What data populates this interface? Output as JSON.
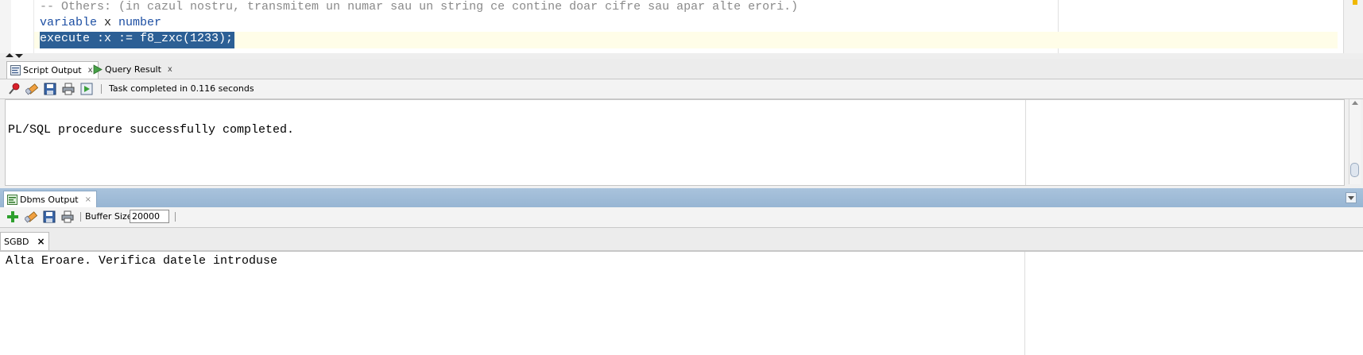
{
  "editor": {
    "line1": "-- Others: (in cazul nostru, transmitem un numar sau un string ce contine doar cifre sau apar alte erori.)",
    "line2_kw1": "variable",
    "line2_plain": " x ",
    "line2_kw2": "number",
    "line3": "execute :x := f8_zxc(1233);"
  },
  "output_tabs": [
    {
      "label": "Script Output",
      "close": "x",
      "icon": "script-output-icon"
    },
    {
      "label": "Query Result",
      "close": "x",
      "icon": "run-triangle-icon"
    }
  ],
  "script_toolbar": {
    "status": "Task completed in 0.116 seconds"
  },
  "script_output": {
    "text": "PL/SQL procedure successfully completed."
  },
  "dbms_panel": {
    "tab_label": "Dbms Output",
    "tab_close": "×",
    "buffer_label": "Buffer Size:",
    "buffer_value": "20000",
    "connection_tab": "SGBD",
    "connection_close": "×",
    "text": "Alta Eroare. Verifica datele introduse"
  },
  "colors": {
    "selection": "#2c5f95",
    "keyword": "#1d4fa3",
    "comment": "#8a8a8a",
    "dbms_header": "#a9c3dc"
  }
}
